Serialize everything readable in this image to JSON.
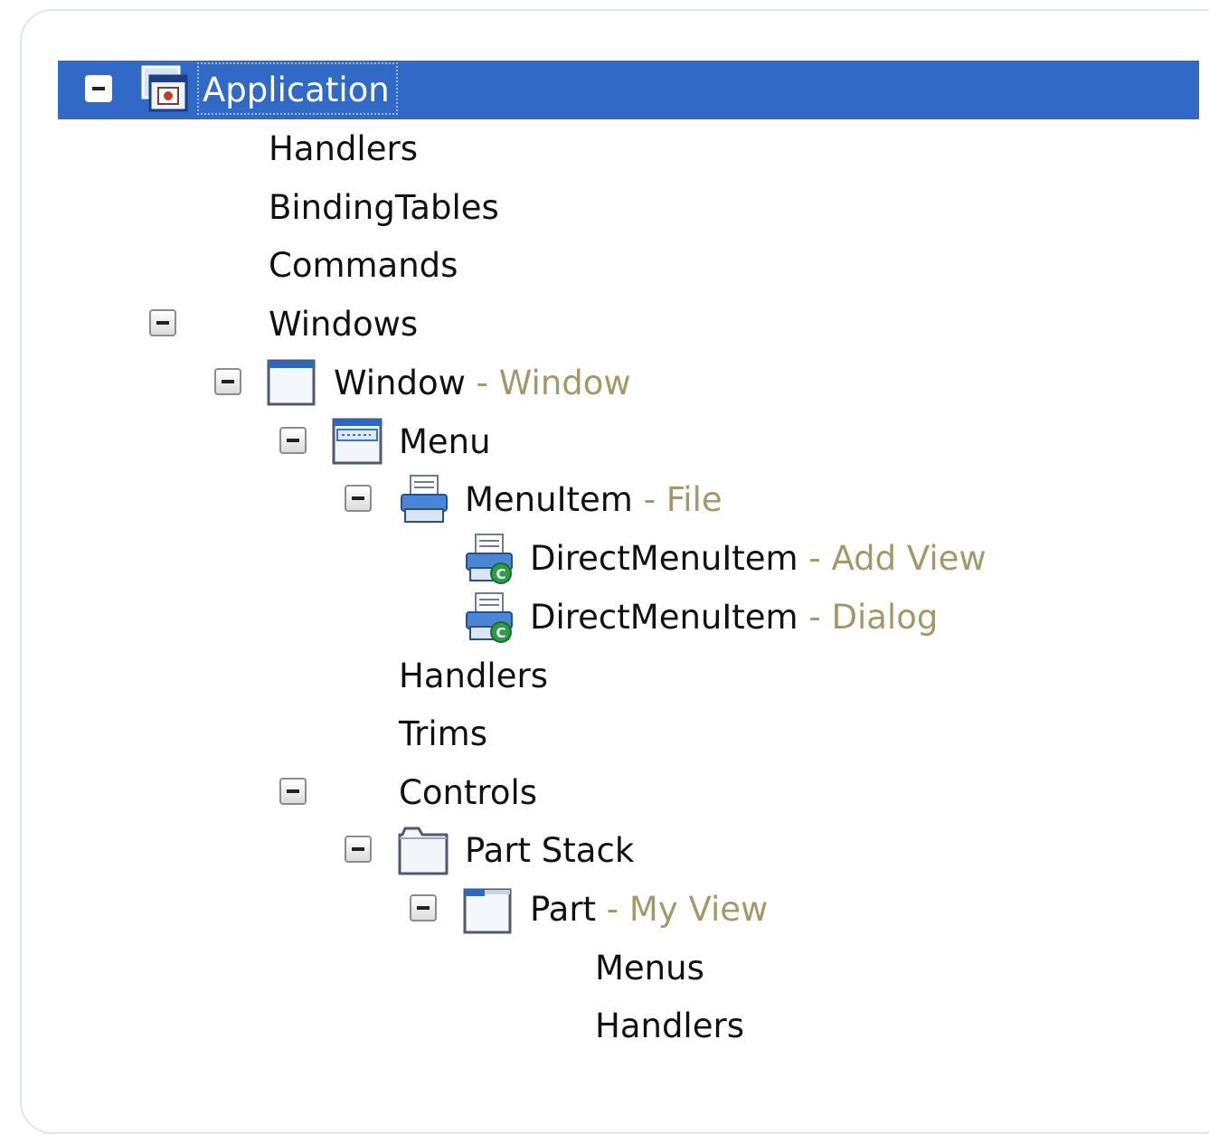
{
  "colors": {
    "selection": "#3169c6",
    "text": "#111111",
    "description": "#a3986a"
  },
  "tree": {
    "application": {
      "label": "Application",
      "icon": "application-icon"
    },
    "handlers_1": {
      "label": "Handlers"
    },
    "binding_tables": {
      "label": "BindingTables"
    },
    "commands": {
      "label": "Commands"
    },
    "windows": {
      "label": "Windows"
    },
    "window": {
      "label": "Window",
      "separator": " - ",
      "description": "Window",
      "icon": "window-icon"
    },
    "menu": {
      "label": "Menu",
      "icon": "menu-icon"
    },
    "menu_item": {
      "label": "MenuItem",
      "separator": " - ",
      "description": "File",
      "icon": "menuitem-icon"
    },
    "direct_menu_item_1": {
      "label": "DirectMenuItem",
      "separator": " - ",
      "description": "Add View",
      "icon": "direct-menuitem-icon"
    },
    "direct_menu_item_2": {
      "label": "DirectMenuItem",
      "separator": " - ",
      "description": "Dialog",
      "icon": "direct-menuitem-icon"
    },
    "handlers_2": {
      "label": "Handlers"
    },
    "trims": {
      "label": "Trims"
    },
    "controls": {
      "label": "Controls"
    },
    "part_stack": {
      "label": "Part Stack",
      "icon": "folder-icon"
    },
    "part": {
      "label": "Part",
      "separator": " - ",
      "description": "My View",
      "icon": "part-icon"
    },
    "menus": {
      "label": "Menus"
    },
    "handlers_3": {
      "label": "Handlers"
    }
  }
}
